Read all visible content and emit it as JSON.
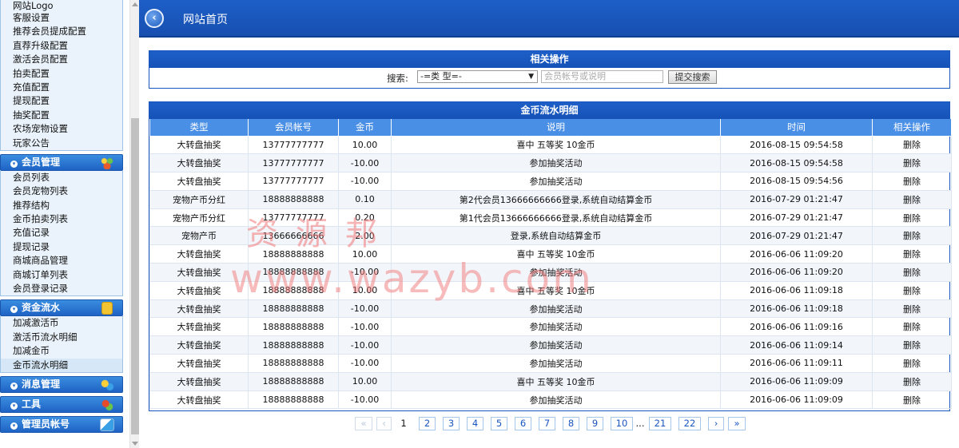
{
  "sidebar": {
    "top_items": [
      "网站Logo",
      "客服设置",
      "推荐会员提成配置",
      "直荐升级配置",
      "激活会员配置",
      "拍卖配置",
      "充值配置",
      "提现配置",
      "抽奖配置",
      "农场宠物设置",
      "玩家公告"
    ],
    "member": {
      "title": "会员管理",
      "items": [
        "会员列表",
        "会员宠物列表",
        "推荐结构",
        "金币拍卖列表",
        "充值记录",
        "提现记录",
        "商城商品管理",
        "商城订单列表",
        "会员登录记录"
      ]
    },
    "funds": {
      "title": "资金流水",
      "items": [
        "加减激活币",
        "激活币流水明细",
        "加减金币",
        "金币流水明细"
      ]
    },
    "messages": {
      "title": "消息管理"
    },
    "tools": {
      "title": "工具"
    },
    "admin": {
      "title": "管理员帐号"
    }
  },
  "header": {
    "title": "网站首页"
  },
  "search_panel": {
    "title": "相关操作",
    "label": "搜索:",
    "select_value": "-=类 型=-",
    "input_placeholder": "会员帐号或说明",
    "button_label": "提交搜索"
  },
  "flow_panel": {
    "title": "金币流水明细",
    "columns": [
      "类型",
      "会员帐号",
      "金币",
      "说明",
      "时间",
      "相关操作"
    ],
    "rows": [
      [
        "大转盘抽奖",
        "13777777777",
        "10.00",
        "喜中 五等奖 10金币",
        "2016-08-15 09:54:58",
        "删除"
      ],
      [
        "大转盘抽奖",
        "13777777777",
        "-10.00",
        "参加抽奖活动",
        "2016-08-15 09:54:58",
        "删除"
      ],
      [
        "大转盘抽奖",
        "13777777777",
        "-10.00",
        "参加抽奖活动",
        "2016-08-15 09:54:56",
        "删除"
      ],
      [
        "宠物产币分红",
        "18888888888",
        "0.10",
        "第2代会员13666666666登录,系统自动结算金币",
        "2016-07-29 01:21:47",
        "删除"
      ],
      [
        "宠物产币分红",
        "13777777777",
        "0.20",
        "第1代会员13666666666登录,系统自动结算金币",
        "2016-07-29 01:21:47",
        "删除"
      ],
      [
        "宠物产币",
        "13666666666",
        "2.00",
        "登录,系统自动结算金币",
        "2016-07-29 01:21:47",
        "删除"
      ],
      [
        "大转盘抽奖",
        "18888888888",
        "10.00",
        "喜中 五等奖 10金币",
        "2016-06-06 11:09:20",
        "删除"
      ],
      [
        "大转盘抽奖",
        "18888888888",
        "-10.00",
        "参加抽奖活动",
        "2016-06-06 11:09:20",
        "删除"
      ],
      [
        "大转盘抽奖",
        "18888888888",
        "10.00",
        "喜中 五等奖 10金币",
        "2016-06-06 11:09:18",
        "删除"
      ],
      [
        "大转盘抽奖",
        "18888888888",
        "-10.00",
        "参加抽奖活动",
        "2016-06-06 11:09:18",
        "删除"
      ],
      [
        "大转盘抽奖",
        "18888888888",
        "-10.00",
        "参加抽奖活动",
        "2016-06-06 11:09:16",
        "删除"
      ],
      [
        "大转盘抽奖",
        "18888888888",
        "-10.00",
        "参加抽奖活动",
        "2016-06-06 11:09:14",
        "删除"
      ],
      [
        "大转盘抽奖",
        "18888888888",
        "-10.00",
        "参加抽奖活动",
        "2016-06-06 11:09:11",
        "删除"
      ],
      [
        "大转盘抽奖",
        "18888888888",
        "10.00",
        "喜中 五等奖 10金币",
        "2016-06-06 11:09:09",
        "删除"
      ],
      [
        "大转盘抽奖",
        "18888888888",
        "-10.00",
        "参加抽奖活动",
        "2016-06-06 11:09:09",
        "删除"
      ]
    ]
  },
  "pagination": {
    "first": "«",
    "prev": "‹",
    "current": "1",
    "pages": [
      "2",
      "3",
      "4",
      "5",
      "6",
      "7",
      "8",
      "9",
      "10"
    ],
    "ellipsis": "...",
    "tail_pages": [
      "21",
      "22"
    ],
    "next": "›",
    "last": "»"
  },
  "watermark": {
    "cn": "资源邦",
    "en": "www.wazyb.com"
  }
}
